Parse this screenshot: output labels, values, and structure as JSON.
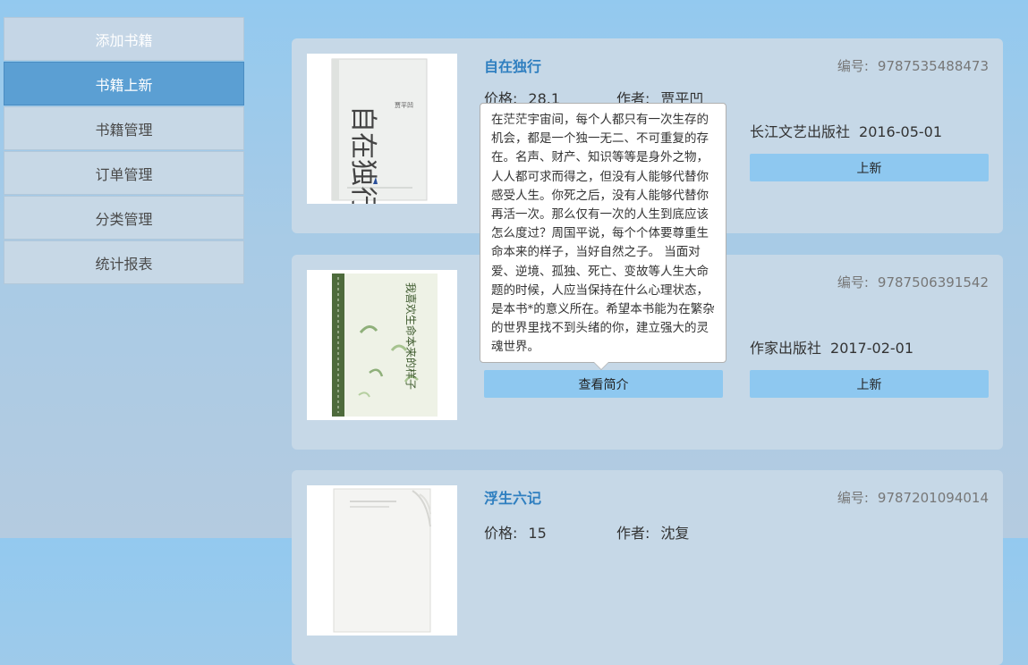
{
  "sidebar": {
    "items": [
      {
        "label": "添加书籍"
      },
      {
        "label": "书籍上新"
      },
      {
        "label": "书籍管理"
      },
      {
        "label": "订单管理"
      },
      {
        "label": "分类管理"
      },
      {
        "label": "统计报表"
      }
    ]
  },
  "labels": {
    "isbn": "编号:",
    "price": "价格:",
    "author": "作者:",
    "publish_button": "上新",
    "intro_button": "查看简介"
  },
  "books": [
    {
      "title": "自在独行",
      "isbn": "9787535488473",
      "price": "28.1",
      "author": "贾平凹",
      "publisher": "长江文艺出版社",
      "date": "2016-05-01",
      "cover_text": [
        "自在独行",
        "贾平凹"
      ]
    },
    {
      "title": "",
      "isbn": "9787506391542",
      "price": "",
      "author": "",
      "publisher": "作家出版社",
      "date": "2017-02-01",
      "cover_text": [
        "我喜欢生命本来的样子"
      ]
    },
    {
      "title": "浮生六记",
      "isbn": "9787201094014",
      "price": "15",
      "author": "沈复",
      "publisher": "",
      "date": ""
    }
  ],
  "tooltip": {
    "text": "在茫茫宇宙间，每个人都只有一次生存的机会，都是一个独一无二、不可重复的存在。名声、财产、知识等等是身外之物，人人都可求而得之，但没有人能够代替你感受人生。你死之后，没有人能够代替你再活一次。那么仅有一次的人生到底应该怎么度过？周国平说，每个个体要尊重生命本来的样子，当好自然之子。 当面对爱、逆境、孤独、死亡、变故等人生大命题的时候，人应当保持在什么心理状态，是本书*的意义所在。希望本书能为在繁杂的世界里找不到头绪的你，建立强大的灵魂世界。"
  }
}
